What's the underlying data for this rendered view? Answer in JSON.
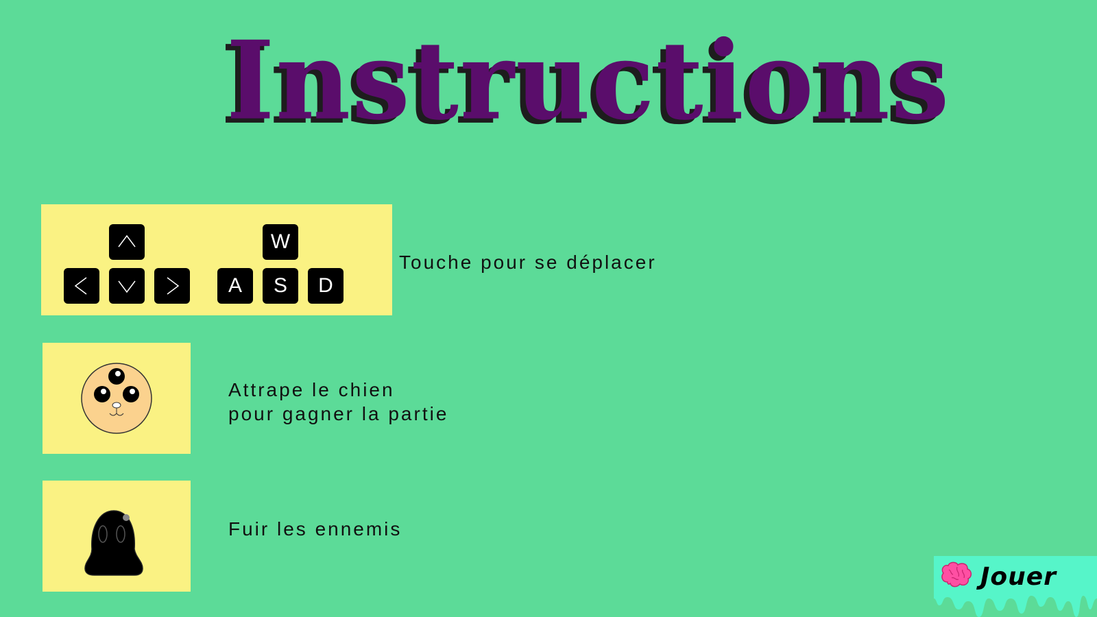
{
  "title": "Instructions",
  "colors": {
    "background": "#5cdb98",
    "panel": "#faf283",
    "title": "#5a0d6b",
    "button": "#56f5c9"
  },
  "controls": {
    "arrow_keys": [
      "up-arrow-icon",
      "left-arrow-icon",
      "down-arrow-icon",
      "right-arrow-icon"
    ],
    "letter_keys": {
      "up": "W",
      "left": "A",
      "down": "S",
      "right": "D"
    },
    "text": "Touche pour se déplacer"
  },
  "goal": {
    "icon": "dog-icon",
    "line1": "Attrape le chien",
    "line2": "pour gagner la partie"
  },
  "enemy": {
    "icon": "ghost-enemy-icon",
    "text": "Fuir les ennemis"
  },
  "play_button": {
    "icon": "brain-icon",
    "label": "Jouer"
  }
}
